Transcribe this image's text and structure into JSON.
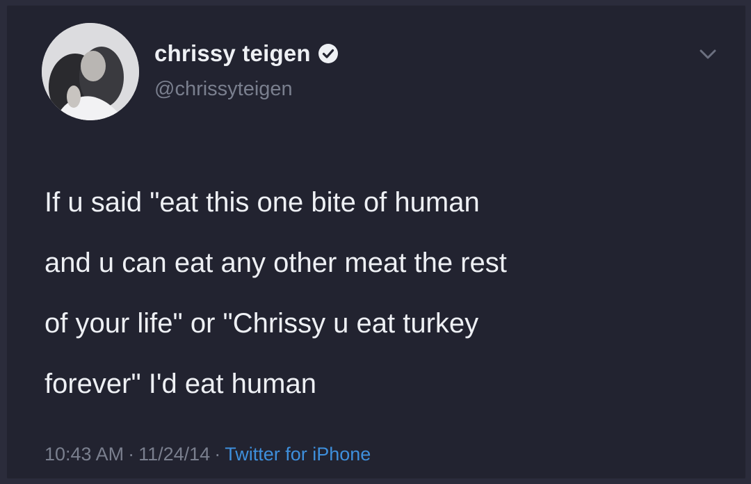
{
  "author": {
    "display_name": "chrissy teigen",
    "handle": "@chrissyteigen",
    "verified": true,
    "avatar_icon": "profile-photo"
  },
  "tweet": {
    "lines": [
      "If u said \"eat this one bite of human",
      "and u can eat any other meat the rest",
      "of your life\" or \"Chrissy u eat turkey",
      "forever\" I'd eat human"
    ]
  },
  "meta": {
    "time": "10:43 AM",
    "separator": "·",
    "date": "11/24/14",
    "source": "Twitter for iPhone"
  },
  "menu_icon": "chevron-down-icon",
  "colors": {
    "background": "#222330",
    "text": "#eef0f4",
    "muted": "#7a7f8e",
    "link": "#3e8fdc"
  }
}
